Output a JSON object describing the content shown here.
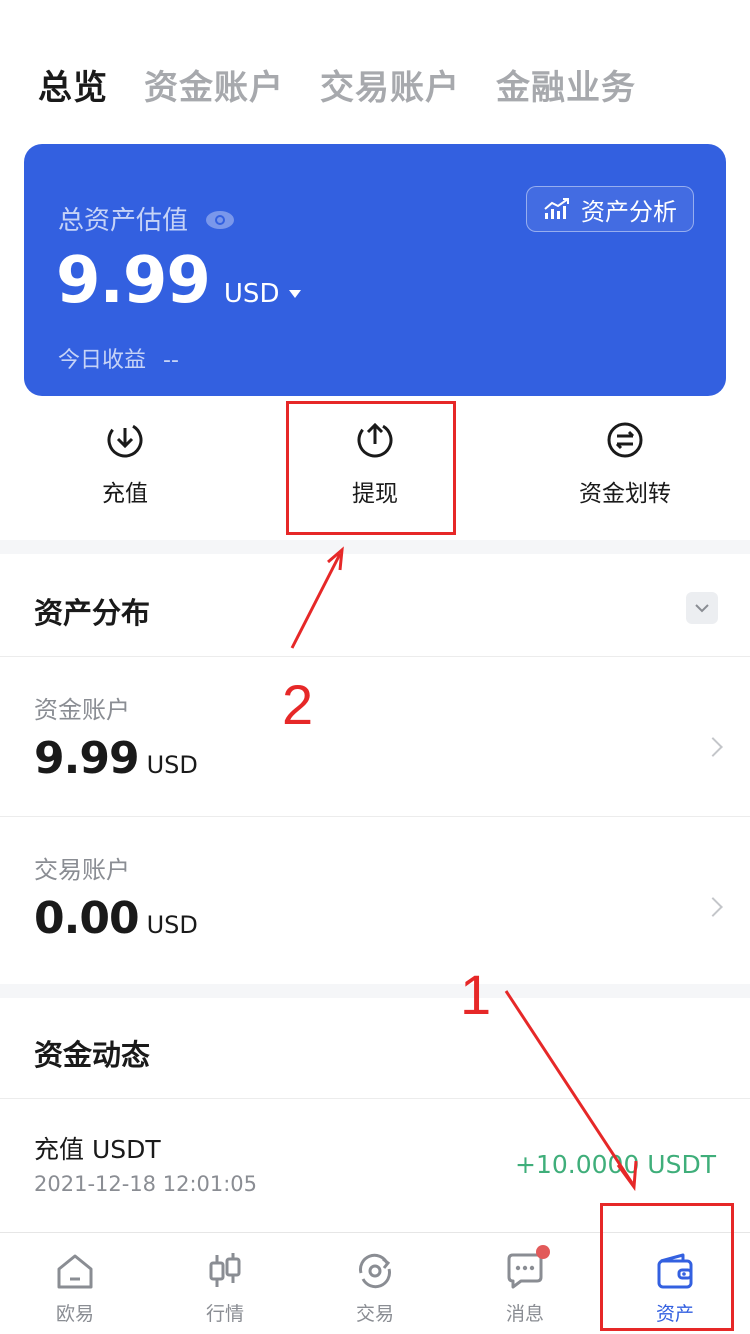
{
  "tabs": [
    "总览",
    "资金账户",
    "交易账户",
    "金融业务"
  ],
  "card": {
    "label": "总资产估值",
    "analysis_label": "资产分析",
    "balance": "9.99",
    "currency": "USD",
    "today_label": "今日收益",
    "today_value": "--"
  },
  "actions": [
    {
      "label": "充值",
      "icon": "deposit-icon"
    },
    {
      "label": "提现",
      "icon": "withdraw-icon"
    },
    {
      "label": "资金划转",
      "icon": "transfer-icon"
    }
  ],
  "distribution": {
    "title": "资产分布",
    "accounts": [
      {
        "name": "资金账户",
        "value": "9.99",
        "unit": "USD"
      },
      {
        "name": "交易账户",
        "value": "0.00",
        "unit": "USD"
      }
    ]
  },
  "activity": {
    "title": "资金动态",
    "items": [
      {
        "title": "充值 USDT",
        "time": "2021-12-18 12:01:05",
        "amount": "+10.0000 USDT"
      }
    ]
  },
  "nav": [
    {
      "label": "欧易",
      "icon": "home-icon"
    },
    {
      "label": "行情",
      "icon": "market-icon"
    },
    {
      "label": "交易",
      "icon": "trade-icon"
    },
    {
      "label": "消息",
      "icon": "message-icon"
    },
    {
      "label": "资产",
      "icon": "wallet-icon",
      "active": true
    }
  ],
  "annotations": [
    "1",
    "2"
  ],
  "colors": {
    "accent": "#3360e0",
    "positive": "#3fae7a",
    "annotation": "#e62828"
  }
}
